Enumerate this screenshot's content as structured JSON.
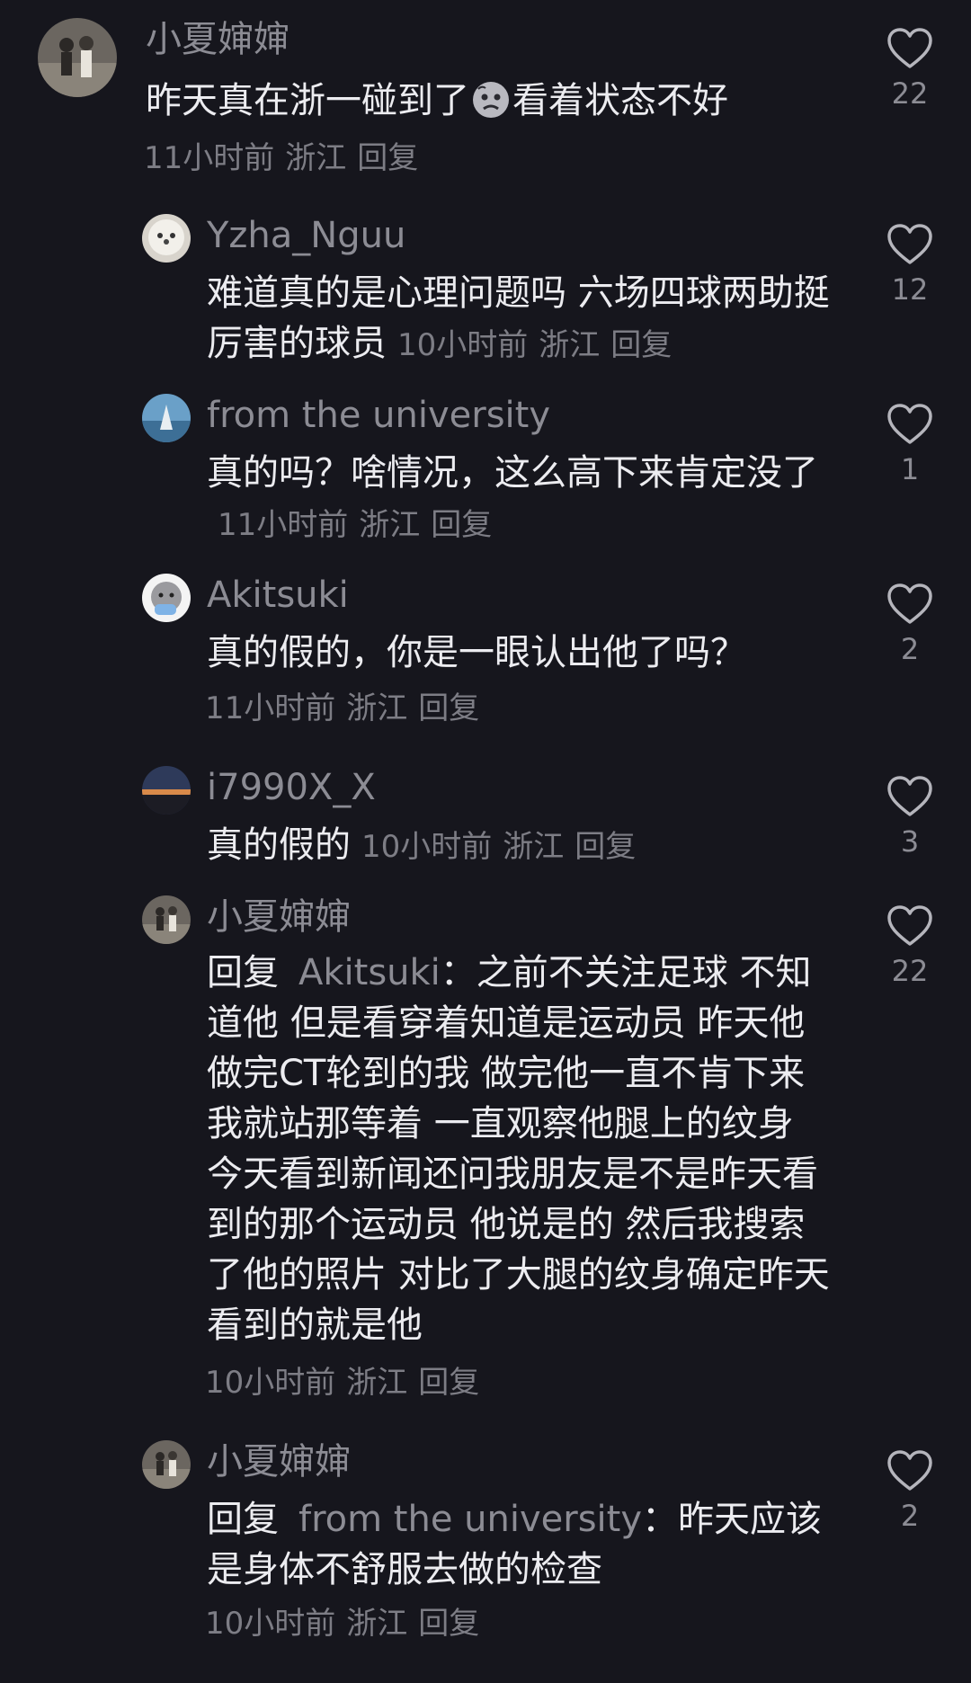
{
  "comments": [
    {
      "username": "小夏婶婶",
      "text_before_emoji": "昨天真在浙一碰到了",
      "emoji": "sad-face-emoji",
      "text_after_emoji": "看着状态不好",
      "time": "11小时前",
      "location": "浙江",
      "reply_label": "回复",
      "likes": "22"
    },
    {
      "username": "Yzha_Nguu",
      "text": "难道真的是心理问题吗 六场四球两助挺厉害的球员",
      "time": "10小时前",
      "location": "浙江",
      "reply_label": "回复",
      "likes": "12"
    },
    {
      "username": "from the university",
      "text": "真的吗？啥情况，这么高下来肯定没了",
      "time": "11小时前",
      "location": "浙江",
      "reply_label": "回复",
      "likes": "1"
    },
    {
      "username": "Akitsuki",
      "text": "真的假的，你是一眼认出他了吗？",
      "time": "11小时前",
      "location": "浙江",
      "reply_label": "回复",
      "likes": "2"
    },
    {
      "username": "i7990X_X",
      "text": "真的假的",
      "time": "10小时前",
      "location": "浙江",
      "reply_label": "回复",
      "likes": "3"
    },
    {
      "username": "小夏婶婶",
      "reply_prefix": "回复",
      "reply_target": "Akitsuki",
      "text": "：之前不关注足球 不知道他 但是看穿着知道是运动员 昨天他做完CT轮到的我 做完他一直不肯下来 我就站那等着 一直观察他腿上的纹身 今天看到新闻还问我朋友是不是昨天看到的那个运动员 他说是的 然后我搜索了他的照片 对比了大腿的纹身确定昨天看到的就是他",
      "time": "10小时前",
      "location": "浙江",
      "reply_label": "回复",
      "likes": "22"
    },
    {
      "username": "小夏婶婶",
      "reply_prefix": "回复",
      "reply_target": "from the university",
      "text": "：昨天应该是身体不舒服去做的检查",
      "time": "10小时前",
      "location": "浙江",
      "reply_label": "回复",
      "likes": "2"
    }
  ],
  "icons": {
    "like": "heart-outline-icon"
  },
  "colors": {
    "background": "#16161d",
    "text": "#ececf0",
    "secondary": "#8c8c94"
  }
}
